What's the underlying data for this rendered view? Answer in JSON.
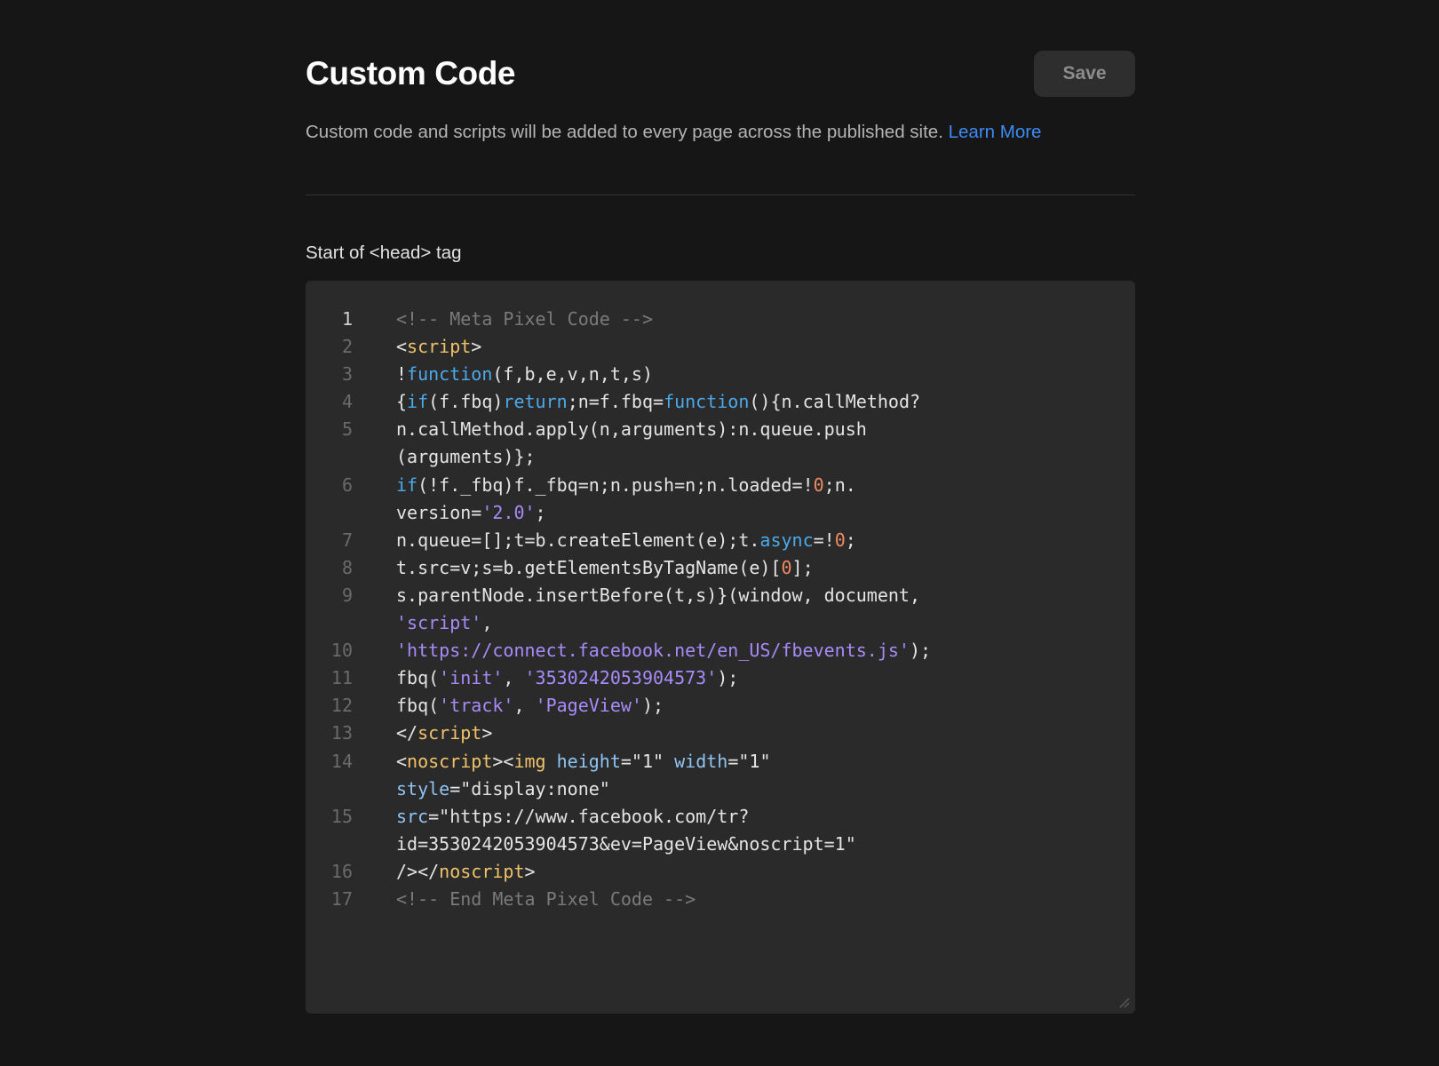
{
  "header": {
    "title": "Custom Code",
    "save_label": "Save"
  },
  "description": {
    "text": "Custom code and scripts will be added to every page across the published site. ",
    "link_label": "Learn More"
  },
  "section": {
    "label": "Start of <head> tag"
  },
  "editor": {
    "active_line": 1,
    "lines": [
      {
        "n": "1",
        "tokens": [
          [
            "comment",
            "<!-- Meta Pixel Code -->"
          ]
        ]
      },
      {
        "n": "2",
        "tokens": [
          [
            "plain",
            "<"
          ],
          [
            "tag",
            "script"
          ],
          [
            "plain",
            ">"
          ]
        ]
      },
      {
        "n": "3",
        "tokens": [
          [
            "plain",
            "!"
          ],
          [
            "kw",
            "function"
          ],
          [
            "plain",
            "(f,b,e,v,n,t,s)"
          ]
        ]
      },
      {
        "n": "4",
        "tokens": [
          [
            "plain",
            "{"
          ],
          [
            "kw",
            "if"
          ],
          [
            "plain",
            "(f.fbq)"
          ],
          [
            "kw",
            "return"
          ],
          [
            "plain",
            ";n=f.fbq="
          ],
          [
            "kw",
            "function"
          ],
          [
            "plain",
            "(){n.callMethod?"
          ]
        ]
      },
      {
        "n": "5",
        "tokens": [
          [
            "plain",
            "n.callMethod.apply(n,arguments):n.queue.push\n(arguments)};"
          ]
        ]
      },
      {
        "n": "6",
        "tokens": [
          [
            "kw",
            "if"
          ],
          [
            "plain",
            "(!f._fbq)f._fbq=n;n.push=n;n.loaded=!"
          ],
          [
            "num",
            "0"
          ],
          [
            "plain",
            ";n.\nversion="
          ],
          [
            "str",
            "'2.0'"
          ],
          [
            "plain",
            ";"
          ]
        ]
      },
      {
        "n": "7",
        "tokens": [
          [
            "plain",
            "n.queue=[];t=b.createElement(e);t."
          ],
          [
            "kw",
            "async"
          ],
          [
            "plain",
            "=!"
          ],
          [
            "num",
            "0"
          ],
          [
            "plain",
            ";"
          ]
        ]
      },
      {
        "n": "8",
        "tokens": [
          [
            "plain",
            "t.src=v;s=b.getElementsByTagName(e)["
          ],
          [
            "num",
            "0"
          ],
          [
            "plain",
            "];"
          ]
        ]
      },
      {
        "n": "9",
        "tokens": [
          [
            "plain",
            "s.parentNode.insertBefore(t,s)}(window, document,\n"
          ],
          [
            "str",
            "'script'"
          ],
          [
            "plain",
            ","
          ]
        ]
      },
      {
        "n": "10",
        "tokens": [
          [
            "str",
            "'https://connect.facebook.net/en_US/fbevents.js'"
          ],
          [
            "plain",
            ");"
          ]
        ]
      },
      {
        "n": "11",
        "tokens": [
          [
            "plain",
            "fbq("
          ],
          [
            "str",
            "'init'"
          ],
          [
            "plain",
            ", "
          ],
          [
            "str",
            "'3530242053904573'"
          ],
          [
            "plain",
            ");"
          ]
        ]
      },
      {
        "n": "12",
        "tokens": [
          [
            "plain",
            "fbq("
          ],
          [
            "str",
            "'track'"
          ],
          [
            "plain",
            ", "
          ],
          [
            "str",
            "'PageView'"
          ],
          [
            "plain",
            ");"
          ]
        ]
      },
      {
        "n": "13",
        "tokens": [
          [
            "plain",
            "</"
          ],
          [
            "tag",
            "script"
          ],
          [
            "plain",
            ">"
          ]
        ]
      },
      {
        "n": "14",
        "tokens": [
          [
            "plain",
            "<"
          ],
          [
            "tag",
            "noscript"
          ],
          [
            "plain",
            "><"
          ],
          [
            "tag",
            "img"
          ],
          [
            "plain",
            " "
          ],
          [
            "attr",
            "height"
          ],
          [
            "plain",
            "=\"1\" "
          ],
          [
            "attr",
            "width"
          ],
          [
            "plain",
            "=\"1\"\n"
          ],
          [
            "attr",
            "style"
          ],
          [
            "plain",
            "=\"display:none\""
          ]
        ]
      },
      {
        "n": "15",
        "tokens": [
          [
            "attr",
            "src"
          ],
          [
            "plain",
            "=\"https://www.facebook.com/tr?\nid=3530242053904573&ev=PageView&noscript=1\""
          ]
        ]
      },
      {
        "n": "16",
        "tokens": [
          [
            "plain",
            "/></"
          ],
          [
            "tag",
            "noscript"
          ],
          [
            "plain",
            ">"
          ]
        ]
      },
      {
        "n": "17",
        "tokens": [
          [
            "comment",
            "<!-- End Meta Pixel Code -->"
          ]
        ]
      }
    ]
  }
}
